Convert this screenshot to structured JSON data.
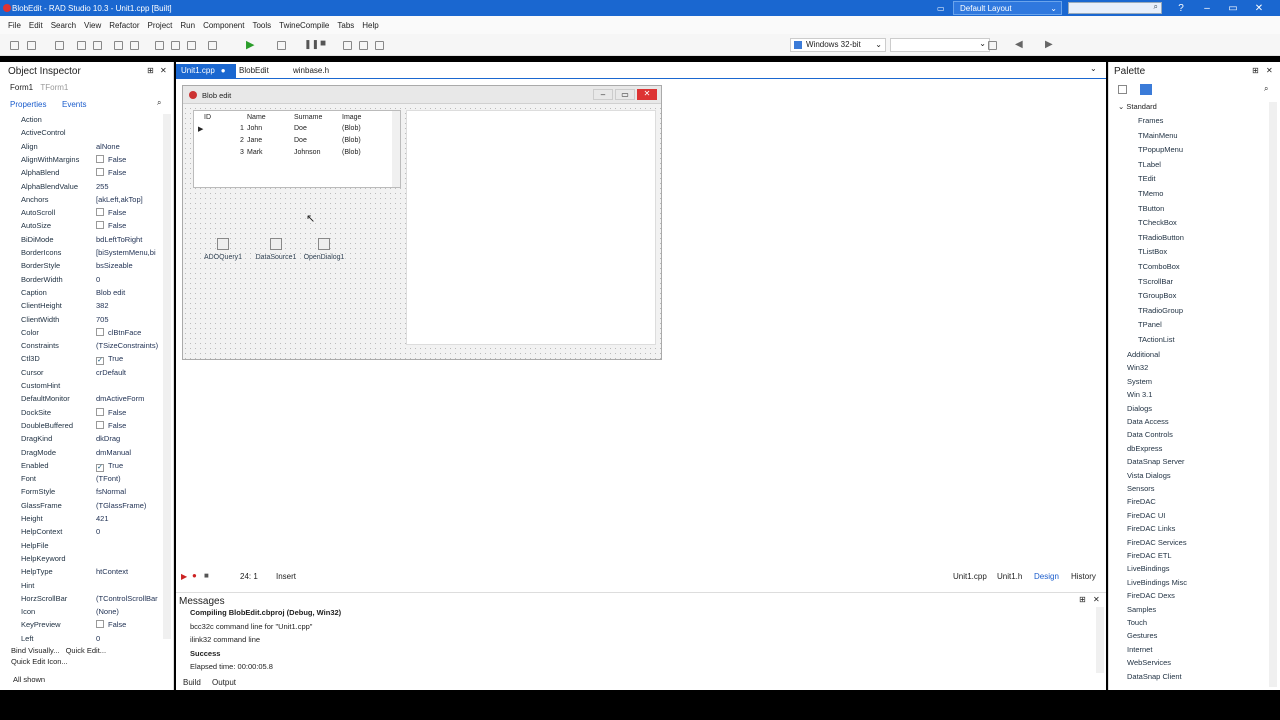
{
  "window": {
    "title": "BlobEdit - RAD Studio 10.3 - Unit1.cpp [Built]",
    "layout": "Default Layout"
  },
  "menu": [
    "File",
    "Edit",
    "Search",
    "View",
    "Refactor",
    "Project",
    "Run",
    "Component",
    "Tools",
    "TwineCompile",
    "Tabs",
    "Help"
  ],
  "toolbar": {
    "platform": "Windows 32-bit"
  },
  "object_inspector": {
    "title": "Object Inspector",
    "selected": "Form1",
    "selected_type": "TForm1",
    "tab_properties": "Properties",
    "tab_events": "Events",
    "rows": [
      {
        "n": "Action",
        "v": ""
      },
      {
        "n": "ActiveControl",
        "v": ""
      },
      {
        "n": "Align",
        "v": "alNone"
      },
      {
        "n": "AlignWithMargins",
        "v": "False",
        "chk": ""
      },
      {
        "n": "AlphaBlend",
        "v": "False",
        "chk": ""
      },
      {
        "n": "AlphaBlendValue",
        "v": "255"
      },
      {
        "n": "Anchors",
        "v": "[akLeft,akTop]"
      },
      {
        "n": "AutoScroll",
        "v": "False",
        "chk": ""
      },
      {
        "n": "AutoSize",
        "v": "False",
        "chk": ""
      },
      {
        "n": "BiDiMode",
        "v": "bdLeftToRight"
      },
      {
        "n": "BorderIcons",
        "v": "[biSystemMenu,bi"
      },
      {
        "n": "BorderStyle",
        "v": "bsSizeable"
      },
      {
        "n": "BorderWidth",
        "v": "0"
      },
      {
        "n": "Caption",
        "v": "Blob edit"
      },
      {
        "n": "ClientHeight",
        "v": "382"
      },
      {
        "n": "ClientWidth",
        "v": "705"
      },
      {
        "n": "Color",
        "v": "clBtnFace",
        "chk": ""
      },
      {
        "n": "Constraints",
        "v": "(TSizeConstraints)"
      },
      {
        "n": "Ctl3D",
        "v": "True",
        "chk": "✓"
      },
      {
        "n": "Cursor",
        "v": "crDefault"
      },
      {
        "n": "CustomHint",
        "v": ""
      },
      {
        "n": "DefaultMonitor",
        "v": "dmActiveForm"
      },
      {
        "n": "DockSite",
        "v": "False",
        "chk": ""
      },
      {
        "n": "DoubleBuffered",
        "v": "False",
        "chk": ""
      },
      {
        "n": "DragKind",
        "v": "dkDrag"
      },
      {
        "n": "DragMode",
        "v": "dmManual"
      },
      {
        "n": "Enabled",
        "v": "True",
        "chk": "✓"
      },
      {
        "n": "Font",
        "v": "(TFont)"
      },
      {
        "n": "FormStyle",
        "v": "fsNormal"
      },
      {
        "n": "GlassFrame",
        "v": "(TGlassFrame)"
      },
      {
        "n": "Height",
        "v": "421"
      },
      {
        "n": "HelpContext",
        "v": "0"
      },
      {
        "n": "HelpFile",
        "v": ""
      },
      {
        "n": "HelpKeyword",
        "v": ""
      },
      {
        "n": "HelpType",
        "v": "htContext"
      },
      {
        "n": "Hint",
        "v": ""
      },
      {
        "n": "HorzScrollBar",
        "v": "(TControlScrollBar"
      },
      {
        "n": "Icon",
        "v": "(None)"
      },
      {
        "n": "KeyPreview",
        "v": "False",
        "chk": ""
      },
      {
        "n": "Left",
        "v": "0"
      }
    ],
    "bind_visually": "Bind Visually...",
    "quick_edit": "Quick Edit...",
    "quick_edit_icon": "Quick Edit Icon...",
    "all_shown": "All shown"
  },
  "editor": {
    "tabs": [
      "Unit1.cpp",
      "BlobEdit",
      "winbase.h"
    ],
    "form_title": "Blob edit",
    "grid_headers": [
      "ID",
      "Name",
      "Surname",
      "Image"
    ],
    "grid_rows": [
      [
        "1",
        "John",
        "Doe",
        "(Blob)"
      ],
      [
        "2",
        "Jane",
        "Doe",
        "(Blob)"
      ],
      [
        "3",
        "Mark",
        "Johnson",
        "(Blob)"
      ]
    ],
    "components": [
      "ADOQuery1",
      "DataSource1",
      "OpenDialog1"
    ],
    "status_pos": "24: 1",
    "status_mode": "Insert",
    "bottom_tabs": [
      "Unit1.cpp",
      "Unit1.h",
      "Design",
      "History"
    ]
  },
  "messages": {
    "title": "Messages",
    "lines": [
      "Compiling BlobEdit.cbproj (Debug, Win32)",
      "bcc32c command line for \"Unit1.cpp\"",
      "ilink32 command line",
      "Success",
      "Elapsed time: 00:00:05.8"
    ],
    "tabs": [
      "Build",
      "Output"
    ]
  },
  "palette": {
    "title": "Palette",
    "open_category": "Standard",
    "items": [
      "Frames",
      "TMainMenu",
      "TPopupMenu",
      "TLabel",
      "TEdit",
      "TMemo",
      "TButton",
      "TCheckBox",
      "TRadioButton",
      "TListBox",
      "TComboBox",
      "TScrollBar",
      "TGroupBox",
      "TRadioGroup",
      "TPanel",
      "TActionList"
    ],
    "categories": [
      "Additional",
      "Win32",
      "System",
      "Win 3.1",
      "Dialogs",
      "Data Access",
      "Data Controls",
      "dbExpress",
      "DataSnap Server",
      "Vista Dialogs",
      "Sensors",
      "FireDAC",
      "FireDAC UI",
      "FireDAC Links",
      "FireDAC Services",
      "FireDAC ETL",
      "LiveBindings",
      "LiveBindings Misc",
      "FireDAC Dexs",
      "Samples",
      "Touch",
      "Gestures",
      "Internet",
      "WebServices",
      "DataSnap Client"
    ]
  }
}
